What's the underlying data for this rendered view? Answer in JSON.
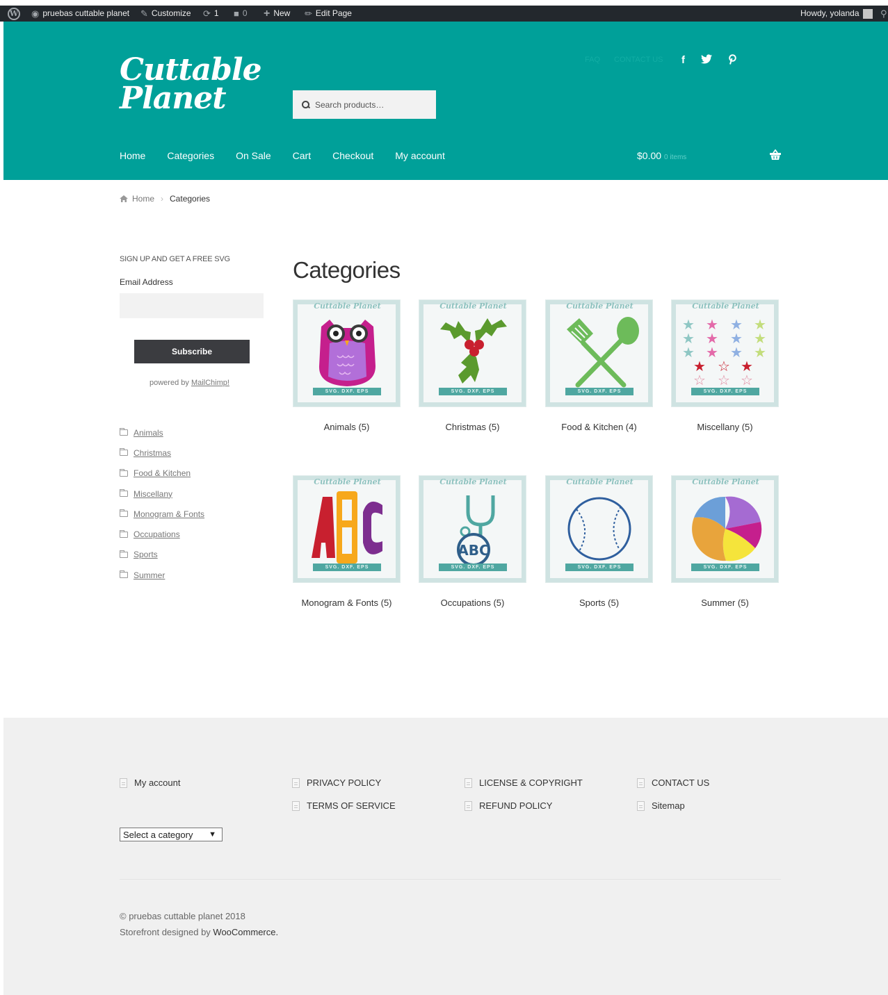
{
  "admin_bar": {
    "site_name": "pruebas cuttable planet",
    "customize": "Customize",
    "updates_count": "1",
    "comments_count": "0",
    "new": "New",
    "edit_page": "Edit Page",
    "howdy": "Howdy, yolanda"
  },
  "header": {
    "logo_line1": "Cuttable",
    "logo_line2": "Planet",
    "search_placeholder": "Search products…",
    "secondary_nav": [
      "FAQ",
      "CONTACT US"
    ],
    "social_icons": [
      "facebook-icon",
      "twitter-icon",
      "pinterest-icon"
    ],
    "main_nav": [
      "Home",
      "Categories",
      "On Sale",
      "Cart",
      "Checkout",
      "My account"
    ],
    "cart_total": "$0.00",
    "cart_items": "0 items",
    "brand_color": "#00a099"
  },
  "breadcrumb": {
    "home": "Home",
    "current": "Categories"
  },
  "sidebar": {
    "signup_title": "SIGN UP AND GET A FREE SVG",
    "email_label": "Email Address",
    "email_value": "",
    "subscribe_label": "Subscribe",
    "powered_by": "powered by ",
    "mailchimp": "MailChimp!",
    "categories": [
      "Animals",
      "Christmas",
      "Food & Kitchen",
      "Miscellany",
      "Monogram & Fonts",
      "Occupations",
      "Sports",
      "Summer"
    ]
  },
  "main": {
    "title": "Categories",
    "tile_brand": "Cuttable Planet",
    "tile_ribbon": "SVG. DXF. EPS",
    "categories": [
      {
        "label": "Animals (5)",
        "icon": "owl-icon"
      },
      {
        "label": "Christmas (5)",
        "icon": "holly-icon"
      },
      {
        "label": "Food & Kitchen (4)",
        "icon": "kitchen-utensils-icon"
      },
      {
        "label": "Miscellany (5)",
        "icon": "stars-icon"
      },
      {
        "label": "Monogram & Fonts (5)",
        "icon": "monogram-abc-icon"
      },
      {
        "label": "Occupations (5)",
        "icon": "stethoscope-icon"
      },
      {
        "label": "Sports (5)",
        "icon": "baseball-icon"
      },
      {
        "label": "Summer (5)",
        "icon": "beach-ball-icon"
      }
    ]
  },
  "footer": {
    "links": [
      "My account",
      "PRIVACY POLICY",
      "TERMS OF SERVICE",
      "LICENSE & COPYRIGHT",
      "REFUND POLICY",
      "CONTACT US",
      "Sitemap"
    ],
    "select_category": "Select a category",
    "copyright": "© pruebas cuttable planet 2018",
    "designed_by": "Storefront designed by ",
    "woocommerce": "WooCommerce."
  }
}
